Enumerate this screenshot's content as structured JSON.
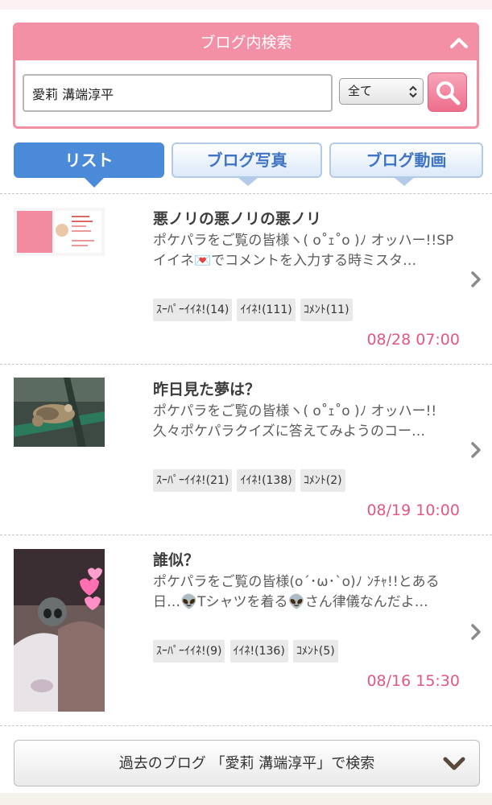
{
  "search": {
    "title": "ブログ内検索",
    "query": "愛莉 溝端淳平",
    "scope": "全て"
  },
  "tabs": [
    {
      "label": "リスト",
      "active": true
    },
    {
      "label": "ブログ写真",
      "active": false
    },
    {
      "label": "ブログ動画",
      "active": false
    }
  ],
  "entries": [
    {
      "title": "悪ノリの悪ノリの悪ノリ",
      "excerpt": "ポケパラをご覧の皆様ヽ( o˚ｪ˚o )ﾉ オッハー!!SPイイネ💌でコメントを入力する時ミスタ…",
      "tags": [
        "ｽｰﾊﾟｰｲｲﾈ!(14)",
        "ｲｲﾈ!(111)",
        "ｺﾒﾝﾄ(11)"
      ],
      "date": "08/28 07:00"
    },
    {
      "title": "昨日見た夢は？",
      "excerpt": "ポケパラをご覧の皆様ヽ( o˚ｪ˚o )ﾉ オッハー!!久々ポケパラクイズに答えてみようのコー…",
      "tags": [
        "ｽｰﾊﾟｰｲｲﾈ!(21)",
        "ｲｲﾈ!(138)",
        "ｺﾒﾝﾄ(2)"
      ],
      "date": "08/19 10:00"
    },
    {
      "title": "誰似？",
      "excerpt": "ポケパラをご覧の皆様(o´･ω･`o)ﾉ ﾝﾁｬ!!とある日…👽Tシャツを着る👽さん律儀なんだよ…",
      "tags": [
        "ｽｰﾊﾟｰｲｲﾈ!(9)",
        "ｲｲﾈ!(136)",
        "ｺﾒﾝﾄ(5)"
      ],
      "date": "08/16 15:30"
    }
  ],
  "past_search_label": "過去のブログ 「愛莉 溝端淳平」で検索",
  "colors": {
    "accent_pink": "#f490a6",
    "tab_blue": "#4b8ad8",
    "date_pink": "#e15880"
  },
  "icons": [
    "chevron-up-icon",
    "updown-icon",
    "magnifier-icon",
    "chevron-right-icon",
    "chevron-down-icon"
  ]
}
